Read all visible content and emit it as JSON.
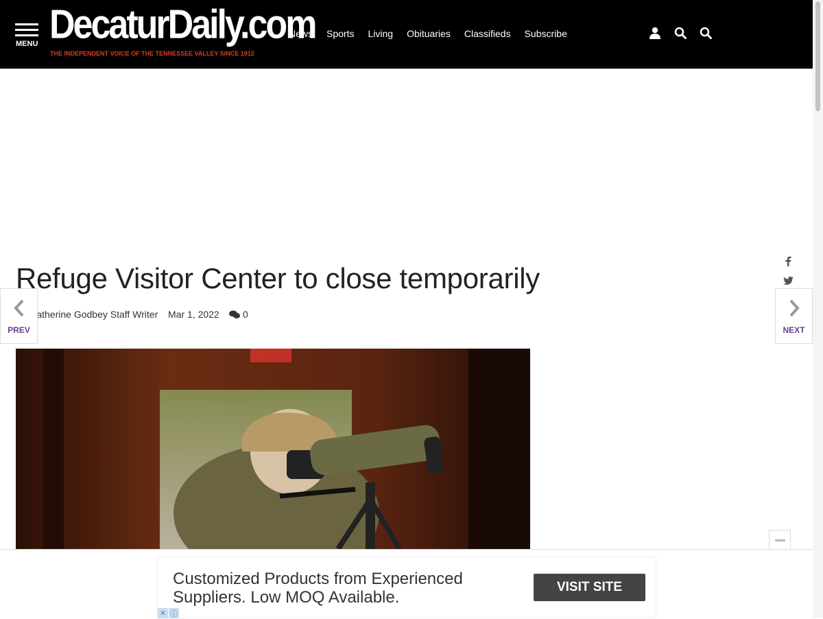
{
  "header": {
    "menu_label": "MENU",
    "logo_text": "DecaturDaily.com",
    "logo_tagline": "THE INDEPENDENT VOICE OF THE TENNESSEE VALLEY SINCE 1912",
    "nav": [
      "News",
      "Sports",
      "Living",
      "Obituaries",
      "Classifieds",
      "Subscribe"
    ],
    "icons": [
      "user-icon",
      "search-icon",
      "search-icon"
    ]
  },
  "article": {
    "title": "Refuge Visitor Center to close temporarily",
    "byline": "By Catherine Godbey Staff Writer",
    "date": "Mar 1, 2022",
    "comment_count": "0"
  },
  "share": [
    "facebook-icon",
    "twitter-icon",
    "email-icon"
  ],
  "pager": {
    "prev_label": "PREV",
    "next_label": "NEXT"
  },
  "ad": {
    "text": "Customized Products from Experienced Suppliers. Low MOQ Available.",
    "cta": "VISIT SITE"
  },
  "colors": {
    "header_bg": "#000000",
    "logo_tag": "#e03a1e",
    "pager_label": "#6a3e8c",
    "cta_bg": "#444444"
  }
}
